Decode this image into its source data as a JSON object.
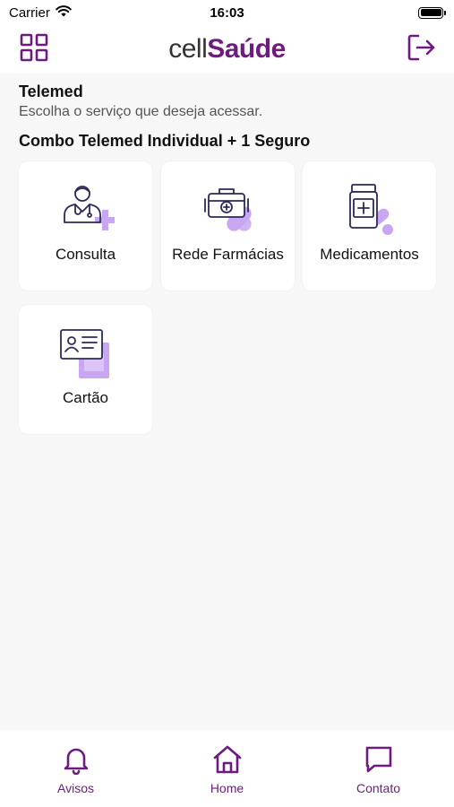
{
  "status_bar": {
    "carrier": "Carrier",
    "time": "16:03",
    "wifi_icon": "wifi-icon",
    "battery_icon": "battery-icon"
  },
  "header": {
    "logo_part1": "cell",
    "logo_part2": "Saúde",
    "menu_icon": "grid-icon",
    "logout_icon": "logout-icon"
  },
  "main": {
    "title": "Telemed",
    "subtitle": "Escolha o serviço que deseja acessar.",
    "combo_title": "Combo Telemed Individual + 1 Seguro",
    "services": [
      {
        "label": "Consulta",
        "icon": "doctor-icon"
      },
      {
        "label": "Rede Farmácias",
        "icon": "first-aid-kit-icon"
      },
      {
        "label": "Medicamentos",
        "icon": "medicine-bottle-icon"
      },
      {
        "label": "Cartão",
        "icon": "id-card-icon"
      }
    ]
  },
  "bottom_nav": {
    "items": [
      {
        "label": "Avisos",
        "icon": "bell-icon"
      },
      {
        "label": "Home",
        "icon": "home-icon"
      },
      {
        "label": "Contato",
        "icon": "chat-icon"
      }
    ]
  },
  "colors": {
    "brand": "#6e1b7f",
    "accent_light": "#c9a6f2",
    "icon_dark": "#2a2a5a",
    "background": "#f7f7f7"
  }
}
